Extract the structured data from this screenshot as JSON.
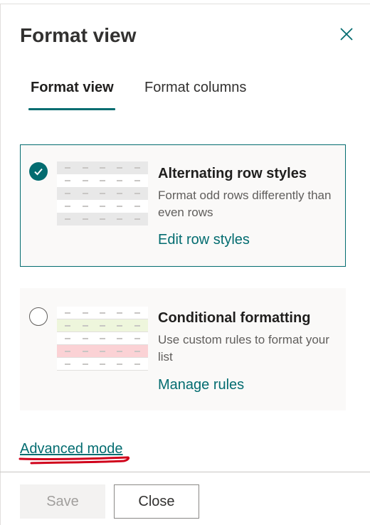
{
  "panel": {
    "title": "Format view"
  },
  "tabs": [
    {
      "label": "Format view",
      "selected": true
    },
    {
      "label": "Format columns",
      "selected": false
    }
  ],
  "options": [
    {
      "title": "Alternating row styles",
      "description": "Format odd rows differently than even rows",
      "link": "Edit row styles",
      "selected": true
    },
    {
      "title": "Conditional formatting",
      "description": "Use custom rules to format your list",
      "link": "Manage rules",
      "selected": false
    }
  ],
  "advanced_mode_label": "Advanced mode",
  "footer": {
    "save_label": "Save",
    "close_label": "Close"
  },
  "colors": {
    "accent": "#036c70",
    "annotation": "#d0021b"
  },
  "icons": [
    "close-icon",
    "checkmark-icon"
  ]
}
